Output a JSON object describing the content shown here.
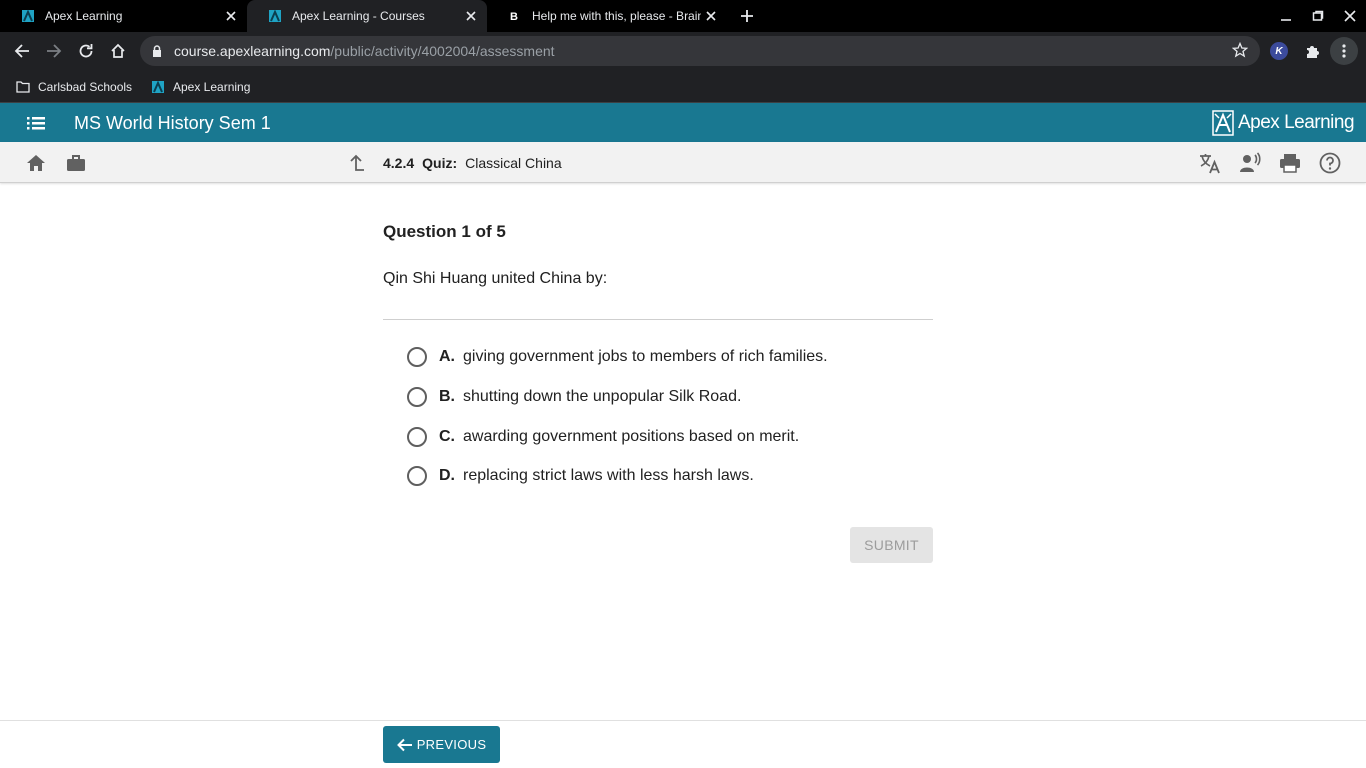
{
  "browser": {
    "tabs": [
      {
        "title": "Apex Learning",
        "favicon": "apex-favicon",
        "active": false
      },
      {
        "title": "Apex Learning - Courses",
        "favicon": "apex-favicon",
        "active": true
      },
      {
        "title": "Help me with this, please - Brainly",
        "favicon": "brainly-favicon",
        "active": false
      }
    ],
    "url_host": "course.apexlearning.com",
    "url_path": "/public/activity/4002004/assessment",
    "extension_badge": "K",
    "bookmarks": [
      {
        "label": "Carlsbad Schools",
        "icon": "folder-icon"
      },
      {
        "label": "Apex Learning",
        "icon": "apex-favicon"
      }
    ]
  },
  "app": {
    "course_title": "MS World History Sem 1",
    "brand": "Apex Learning",
    "brand_color": "#197891",
    "activity_number": "4.2.4",
    "activity_kind": "Quiz:",
    "activity_title": "Classical China"
  },
  "quiz": {
    "heading": "Question 1 of 5",
    "question": "Qin Shi Huang united China by:",
    "options": [
      {
        "letter": "A.",
        "text": "giving government jobs to members of rich families."
      },
      {
        "letter": "B.",
        "text": "shutting down the unpopular Silk Road."
      },
      {
        "letter": "C.",
        "text": "awarding government positions based on merit."
      },
      {
        "letter": "D.",
        "text": "replacing strict laws with less harsh laws."
      }
    ],
    "submit_label": "SUBMIT",
    "previous_label": "PREVIOUS"
  }
}
